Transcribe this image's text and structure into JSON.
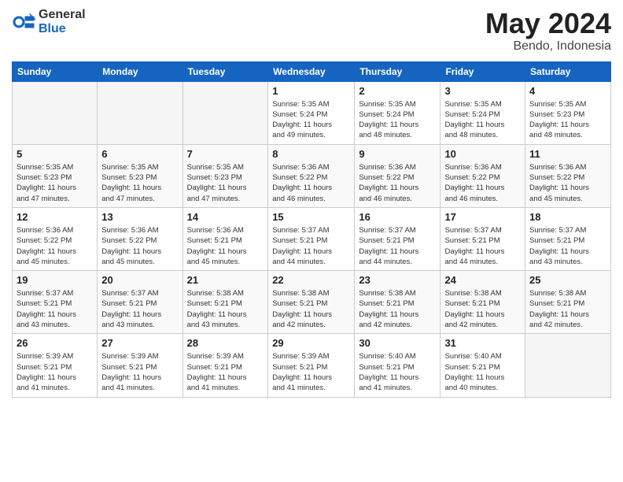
{
  "logo": {
    "general": "General",
    "blue": "Blue"
  },
  "title": "May 2024",
  "location": "Bendo, Indonesia",
  "days_of_week": [
    "Sunday",
    "Monday",
    "Tuesday",
    "Wednesday",
    "Thursday",
    "Friday",
    "Saturday"
  ],
  "weeks": [
    [
      {
        "day": "",
        "info": ""
      },
      {
        "day": "",
        "info": ""
      },
      {
        "day": "",
        "info": ""
      },
      {
        "day": "1",
        "info": "Sunrise: 5:35 AM\nSunset: 5:24 PM\nDaylight: 11 hours\nand 49 minutes."
      },
      {
        "day": "2",
        "info": "Sunrise: 5:35 AM\nSunset: 5:24 PM\nDaylight: 11 hours\nand 48 minutes."
      },
      {
        "day": "3",
        "info": "Sunrise: 5:35 AM\nSunset: 5:24 PM\nDaylight: 11 hours\nand 48 minutes."
      },
      {
        "day": "4",
        "info": "Sunrise: 5:35 AM\nSunset: 5:23 PM\nDaylight: 11 hours\nand 48 minutes."
      }
    ],
    [
      {
        "day": "5",
        "info": "Sunrise: 5:35 AM\nSunset: 5:23 PM\nDaylight: 11 hours\nand 47 minutes."
      },
      {
        "day": "6",
        "info": "Sunrise: 5:35 AM\nSunset: 5:23 PM\nDaylight: 11 hours\nand 47 minutes."
      },
      {
        "day": "7",
        "info": "Sunrise: 5:35 AM\nSunset: 5:23 PM\nDaylight: 11 hours\nand 47 minutes."
      },
      {
        "day": "8",
        "info": "Sunrise: 5:36 AM\nSunset: 5:22 PM\nDaylight: 11 hours\nand 46 minutes."
      },
      {
        "day": "9",
        "info": "Sunrise: 5:36 AM\nSunset: 5:22 PM\nDaylight: 11 hours\nand 46 minutes."
      },
      {
        "day": "10",
        "info": "Sunrise: 5:36 AM\nSunset: 5:22 PM\nDaylight: 11 hours\nand 46 minutes."
      },
      {
        "day": "11",
        "info": "Sunrise: 5:36 AM\nSunset: 5:22 PM\nDaylight: 11 hours\nand 45 minutes."
      }
    ],
    [
      {
        "day": "12",
        "info": "Sunrise: 5:36 AM\nSunset: 5:22 PM\nDaylight: 11 hours\nand 45 minutes."
      },
      {
        "day": "13",
        "info": "Sunrise: 5:36 AM\nSunset: 5:22 PM\nDaylight: 11 hours\nand 45 minutes."
      },
      {
        "day": "14",
        "info": "Sunrise: 5:36 AM\nSunset: 5:21 PM\nDaylight: 11 hours\nand 45 minutes."
      },
      {
        "day": "15",
        "info": "Sunrise: 5:37 AM\nSunset: 5:21 PM\nDaylight: 11 hours\nand 44 minutes."
      },
      {
        "day": "16",
        "info": "Sunrise: 5:37 AM\nSunset: 5:21 PM\nDaylight: 11 hours\nand 44 minutes."
      },
      {
        "day": "17",
        "info": "Sunrise: 5:37 AM\nSunset: 5:21 PM\nDaylight: 11 hours\nand 44 minutes."
      },
      {
        "day": "18",
        "info": "Sunrise: 5:37 AM\nSunset: 5:21 PM\nDaylight: 11 hours\nand 43 minutes."
      }
    ],
    [
      {
        "day": "19",
        "info": "Sunrise: 5:37 AM\nSunset: 5:21 PM\nDaylight: 11 hours\nand 43 minutes."
      },
      {
        "day": "20",
        "info": "Sunrise: 5:37 AM\nSunset: 5:21 PM\nDaylight: 11 hours\nand 43 minutes."
      },
      {
        "day": "21",
        "info": "Sunrise: 5:38 AM\nSunset: 5:21 PM\nDaylight: 11 hours\nand 43 minutes."
      },
      {
        "day": "22",
        "info": "Sunrise: 5:38 AM\nSunset: 5:21 PM\nDaylight: 11 hours\nand 42 minutes."
      },
      {
        "day": "23",
        "info": "Sunrise: 5:38 AM\nSunset: 5:21 PM\nDaylight: 11 hours\nand 42 minutes."
      },
      {
        "day": "24",
        "info": "Sunrise: 5:38 AM\nSunset: 5:21 PM\nDaylight: 11 hours\nand 42 minutes."
      },
      {
        "day": "25",
        "info": "Sunrise: 5:38 AM\nSunset: 5:21 PM\nDaylight: 11 hours\nand 42 minutes."
      }
    ],
    [
      {
        "day": "26",
        "info": "Sunrise: 5:39 AM\nSunset: 5:21 PM\nDaylight: 11 hours\nand 41 minutes."
      },
      {
        "day": "27",
        "info": "Sunrise: 5:39 AM\nSunset: 5:21 PM\nDaylight: 11 hours\nand 41 minutes."
      },
      {
        "day": "28",
        "info": "Sunrise: 5:39 AM\nSunset: 5:21 PM\nDaylight: 11 hours\nand 41 minutes."
      },
      {
        "day": "29",
        "info": "Sunrise: 5:39 AM\nSunset: 5:21 PM\nDaylight: 11 hours\nand 41 minutes."
      },
      {
        "day": "30",
        "info": "Sunrise: 5:40 AM\nSunset: 5:21 PM\nDaylight: 11 hours\nand 41 minutes."
      },
      {
        "day": "31",
        "info": "Sunrise: 5:40 AM\nSunset: 5:21 PM\nDaylight: 11 hours\nand 40 minutes."
      },
      {
        "day": "",
        "info": ""
      }
    ]
  ]
}
